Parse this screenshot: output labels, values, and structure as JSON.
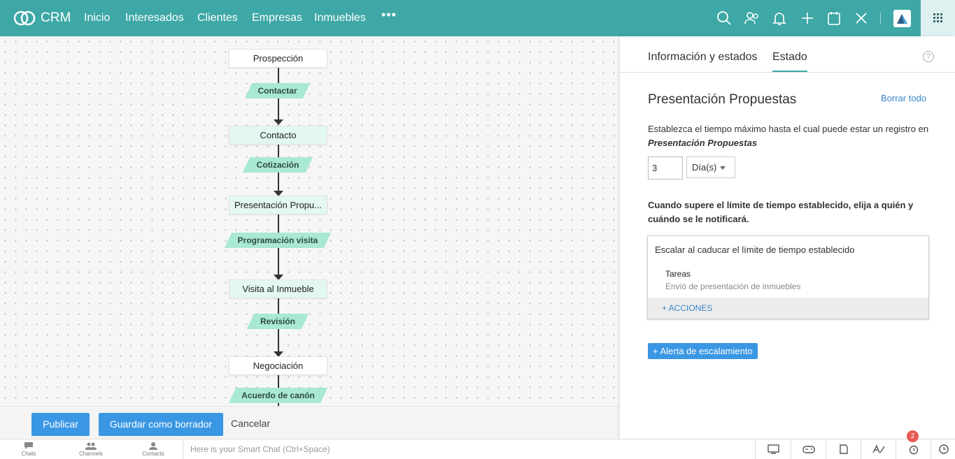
{
  "header": {
    "brand": "CRM",
    "nav": [
      "Inicio",
      "Interesados",
      "Clientes",
      "Empresas",
      "Inmuebles"
    ],
    "more": "•••"
  },
  "flow": {
    "stages": [
      "Prospección",
      "Contacto",
      "Presentación Propuestas",
      "Visita al Inmueble",
      "Negociación"
    ],
    "stage_display": [
      "Prospección",
      "Contacto",
      "Presentación Propu...",
      "Visita al Inmueble",
      "Negociación"
    ],
    "transitions": [
      "Contactar",
      "Cotización",
      "Programación visita",
      "Revisión",
      "Acuerdo de canón"
    ]
  },
  "actions": {
    "publish": "Publicar",
    "save_draft": "Guardar como borrador",
    "cancel": "Cancelar"
  },
  "panel": {
    "tabs": [
      "Información y estados",
      "Estado"
    ],
    "help": "?",
    "title": "Presentación Propuestas",
    "clear_all": "Borrar todo",
    "description": "Establezca el tiempo máximo hasta el cual puede estar un registro en",
    "description_stage": "Presentación Propuestas",
    "time_value": "3",
    "time_unit": "Día(s)",
    "notice": "Cuando supere el límite de tiempo establecido, elija a quién y cuándo se le notificará.",
    "escalation": {
      "title": "Escalar al caducar el límite de tiempo establecido",
      "task_label": "Tareas",
      "task_desc": "Envió de presentación de inmuebles",
      "actions": "+ ACCIONES"
    },
    "alert_button": "+ Alerta de escalamiento"
  },
  "footer": {
    "items": [
      "Chats",
      "Channels",
      "Contacts"
    ],
    "chat_placeholder": "Here is your Smart Chat (Ctrl+Space)",
    "badge": "2"
  }
}
